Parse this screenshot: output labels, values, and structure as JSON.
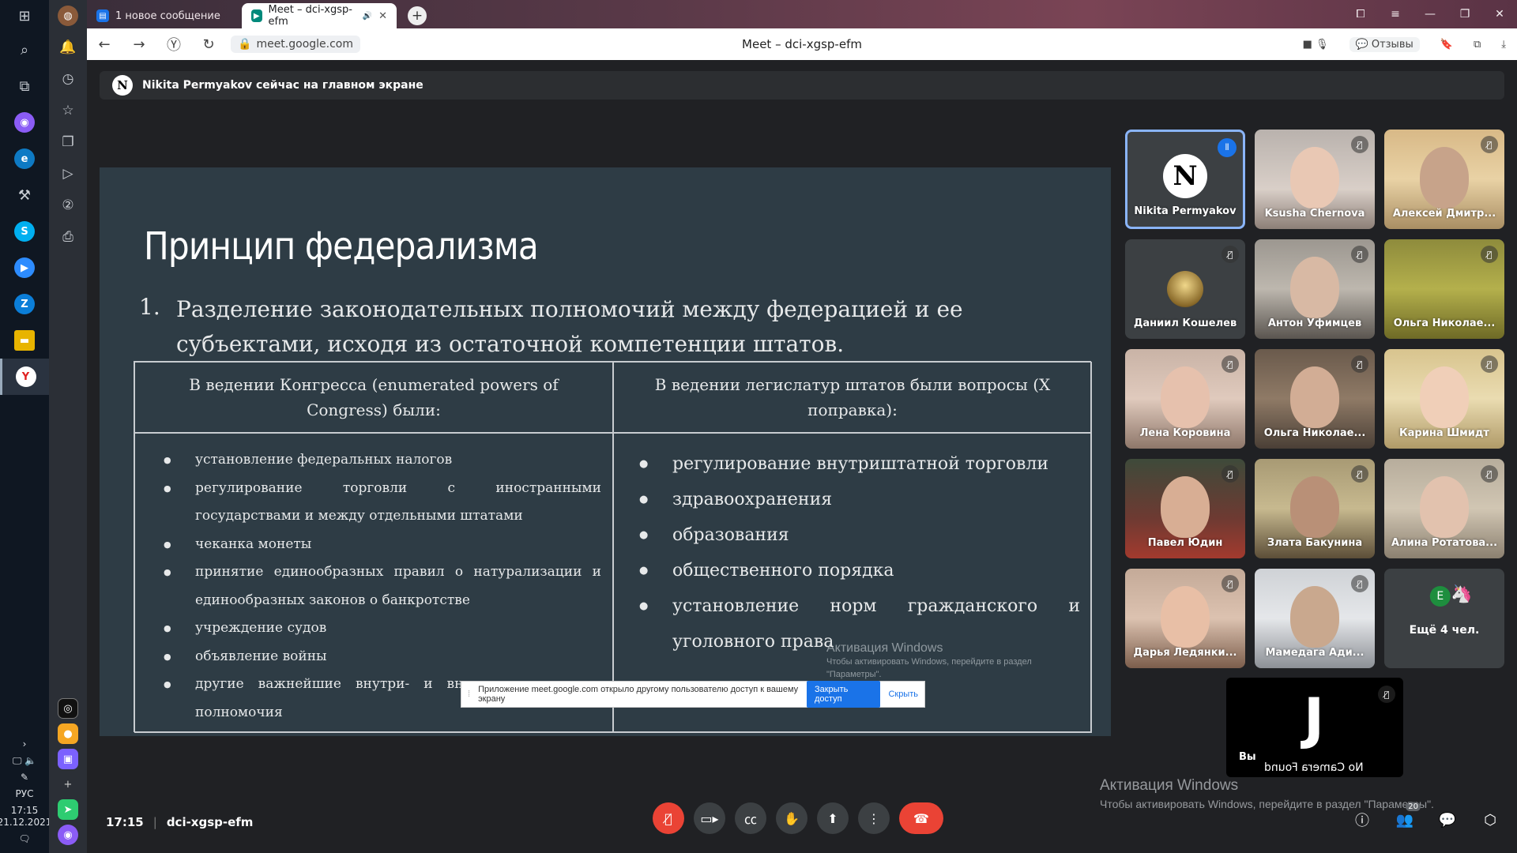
{
  "taskbar": {
    "clock": {
      "time": "17:15",
      "date": "21.12.2021"
    },
    "lang": "РУС"
  },
  "browser": {
    "tabs": [
      {
        "label": "1 новое сообщение"
      },
      {
        "label": "Meet – dci-xgsp-efm"
      }
    ],
    "url": "meet.google.com",
    "page_title": "Meet – dci-xgsp-efm",
    "feedback_label": "Отзывы"
  },
  "meet": {
    "banner": "Nikita Permyakov сейчас на главном экране",
    "slide": {
      "title": "Принцип федерализма",
      "point_num": "1.",
      "point_text": "Разделение законодательных полномочий между федерацией и ее субъектами, исходя из остаточной компетенции штатов.",
      "col_left_header": "В ведении Конгресса (enumerated powers of Congress) были:",
      "col_right_header": "В ведении легислатур штатов были вопросы (X поправка):",
      "left_items": [
        "установление федеральных налогов",
        "регулирование торговли с иностранными государствами и между отдельными штатами",
        "чеканка монеты",
        "принятие единообразных правил о натурализации и единообразных законов о банкротстве",
        "учреждение судов",
        "объявление войны",
        "другие важнейшие внутри- и внешнеполитические полномочия"
      ],
      "right_items": [
        "регулирование внутриштатной торговли",
        "здравоохранения",
        "образования",
        "общественного порядка",
        "установление норм гражданского и уголовного права"
      ],
      "activation_title": "Активация Windows",
      "activation_text": "Чтобы активировать Windows, перейдите в раздел \"Параметры\"."
    },
    "share_notice": {
      "text": "Приложение meet.google.com открыло другому пользователю доступ к вашему экрану",
      "stop_button": "Закрыть доступ",
      "hide_link": "Скрыть"
    },
    "participants": [
      {
        "name": "Nikita Permyakov"
      },
      {
        "name": "Ksusha Chernova"
      },
      {
        "name": "Алексей Дмитр..."
      },
      {
        "name": "Даниил Кошелев"
      },
      {
        "name": "Антон Уфимцев"
      },
      {
        "name": "Ольга Николае..."
      },
      {
        "name": "Лена Коровина"
      },
      {
        "name": "Ольга Николае..."
      },
      {
        "name": "Карина Шмидт"
      },
      {
        "name": "Павел Юдин"
      },
      {
        "name": "Злата Бакунина"
      },
      {
        "name": "Алина Ротатова..."
      },
      {
        "name": "Дарья Ледянки..."
      },
      {
        "name": "Мамедага Ади..."
      }
    ],
    "more": {
      "initial": "E",
      "label": "Ещё 4 чел."
    },
    "self": {
      "label": "Вы",
      "camera": "No Camera Found"
    },
    "activation": {
      "title": "Активация Windows",
      "text": "Чтобы активировать Windows, перейдите в раздел \"Параметры\"."
    },
    "bottom": {
      "time": "17:15",
      "code": "dci-xgsp-efm",
      "people_count": "20"
    }
  }
}
